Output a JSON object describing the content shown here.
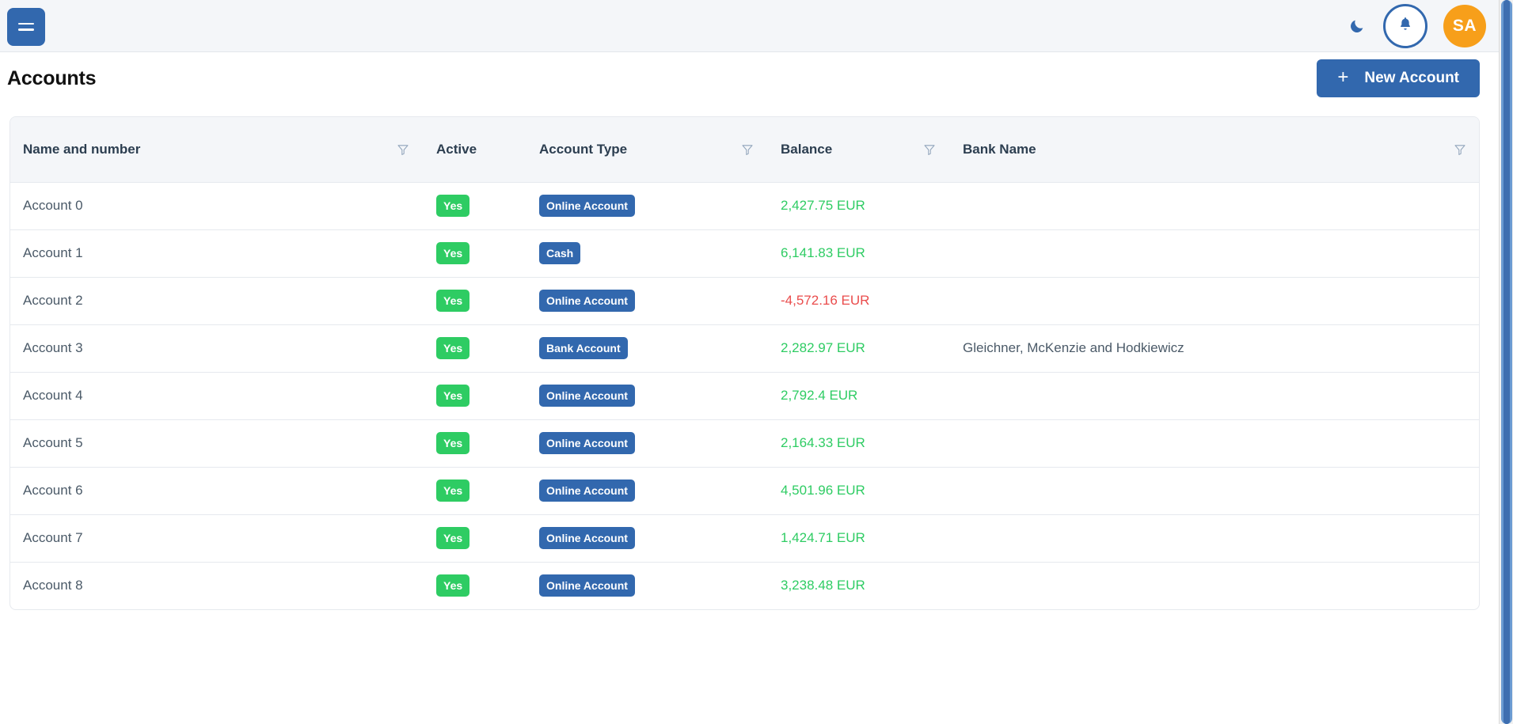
{
  "topbar": {
    "menu_button_name": "menu",
    "dark_mode_icon": "moon-icon",
    "notifications_icon": "bell-icon",
    "avatar_initials": "SA"
  },
  "page": {
    "title": "Accounts",
    "new_account_label": "New Account",
    "new_account_plus": "+"
  },
  "table": {
    "columns": [
      {
        "label": "Name and number",
        "filterable": true
      },
      {
        "label": "Active",
        "filterable": false
      },
      {
        "label": "Account Type",
        "filterable": true
      },
      {
        "label": "Balance",
        "filterable": true
      },
      {
        "label": "Bank Name",
        "filterable": true
      }
    ],
    "rows": [
      {
        "name": "Account 0",
        "active": "Yes",
        "type": "Online Account",
        "balance": "2,427.75 EUR",
        "balance_sign": "pos",
        "bank": ""
      },
      {
        "name": "Account 1",
        "active": "Yes",
        "type": "Cash",
        "balance": "6,141.83 EUR",
        "balance_sign": "pos",
        "bank": ""
      },
      {
        "name": "Account 2",
        "active": "Yes",
        "type": "Online Account",
        "balance": "-4,572.16 EUR",
        "balance_sign": "neg",
        "bank": ""
      },
      {
        "name": "Account 3",
        "active": "Yes",
        "type": "Bank Account",
        "balance": "2,282.97 EUR",
        "balance_sign": "pos",
        "bank": "Gleichner, McKenzie and Hodkiewicz"
      },
      {
        "name": "Account 4",
        "active": "Yes",
        "type": "Online Account",
        "balance": "2,792.4 EUR",
        "balance_sign": "pos",
        "bank": ""
      },
      {
        "name": "Account 5",
        "active": "Yes",
        "type": "Online Account",
        "balance": "2,164.33 EUR",
        "balance_sign": "pos",
        "bank": ""
      },
      {
        "name": "Account 6",
        "active": "Yes",
        "type": "Online Account",
        "balance": "4,501.96 EUR",
        "balance_sign": "pos",
        "bank": ""
      },
      {
        "name": "Account 7",
        "active": "Yes",
        "type": "Online Account",
        "balance": "1,424.71 EUR",
        "balance_sign": "pos",
        "bank": ""
      },
      {
        "name": "Account 8",
        "active": "Yes",
        "type": "Online Account",
        "balance": "3,238.48 EUR",
        "balance_sign": "pos",
        "bank": ""
      }
    ]
  },
  "colors": {
    "primary": "#3268ae",
    "positive": "#2ecc63",
    "negative": "#ea4c4c",
    "avatar": "#f79f1a",
    "topbar_bg": "#f4f6f9"
  }
}
